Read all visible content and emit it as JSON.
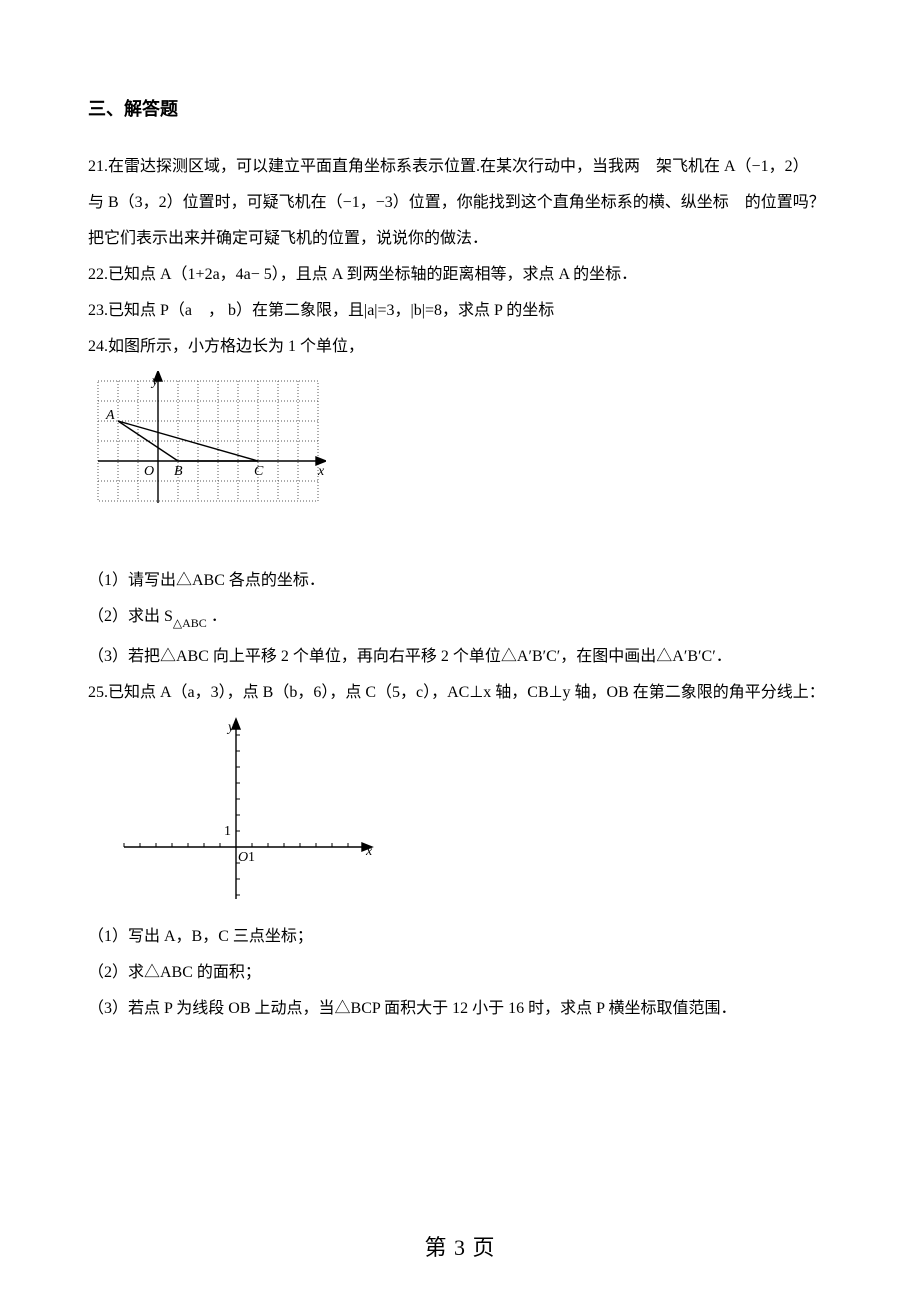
{
  "section": {
    "heading": "三、解答题"
  },
  "q21": {
    "line1": "21.在雷达探测区域，可以建立平面直角坐标系表示位置.在某次行动中，当我两　架飞机在 A（−1，2）",
    "line2": "与 B（3，2）位置时，可疑飞机在（−1，−3）位置，你能找到这个直角坐标系的横、纵坐标　的位置吗？",
    "line3": "把它们表示出来并确定可疑飞机的位置，说说你的做法．"
  },
  "q22": {
    "line": "22.已知点 A（1+2a，4a− 5），且点 A 到两坐标轴的距离相等，求点 A 的坐标．"
  },
  "q23": {
    "line": "23.已知点 P（a　， b）在第二象限，且|a|=3，|b|=8，求点 P 的坐标"
  },
  "q24": {
    "intro": "24.如图所示，小方格边长为 1 个单位，",
    "p1": "（1）请写出△ABC 各点的坐标．",
    "p2_prefix": "（2）求出 S",
    "p2_sub": "△ABC",
    "p2_suffix": " ．",
    "p3": "（3）若把△ABC 向上平移 2 个单位，再向右平移 2 个单位△A′B′C′，在图中画出△A′B′C′．",
    "fig": {
      "xlabel": "x",
      "ylabel": "y",
      "origin": "O",
      "A": "A",
      "B": "B",
      "C": "C",
      "A_coord": [
        -2,
        2
      ],
      "B_coord": [
        1,
        0
      ],
      "C_coord": [
        5,
        0
      ]
    }
  },
  "q25": {
    "intro": "25.已知点 A（a，3），点 B（b，6），点 C（5，c），AC⊥x 轴，CB⊥y 轴，OB 在第二象限的角平分线上：",
    "p1": "（1）写出 A，B，C 三点坐标；",
    "p2": "（2）求△ABC 的面积；",
    "p3": "（3）若点 P 为线段 OB 上动点，当△BCP 面积大于 12 小于 16 时，求点 P 横坐标取值范围．",
    "fig": {
      "xlabel": "x",
      "ylabel": "y",
      "origin": "O",
      "one": "1"
    }
  },
  "footer": "第 3 页",
  "chart_data": [
    {
      "type": "line",
      "name": "figure_q24",
      "description": "Dotted-grid coordinate plane with triangle ABC. Grid cell = 1 unit.",
      "x_range": [
        -3,
        8
      ],
      "y_range": [
        -2,
        4
      ],
      "points": {
        "A": [
          -2,
          2
        ],
        "B": [
          1,
          0
        ],
        "C": [
          5,
          0
        ]
      },
      "segments": [
        [
          "A",
          "B"
        ],
        [
          "A",
          "C"
        ],
        [
          "B",
          "C"
        ]
      ],
      "axis_labels": {
        "x": "x",
        "y": "y",
        "origin": "O"
      }
    },
    {
      "type": "line",
      "name": "figure_q25",
      "description": "Empty coordinate axes with tick marks; tick at 1 labeled on both axes.",
      "x_range": [
        -7,
        8
      ],
      "y_range": [
        -3,
        7
      ],
      "axis_labels": {
        "x": "x",
        "y": "y",
        "origin": "O"
      },
      "tick_labels": {
        "x": [
          1
        ],
        "y": [
          1
        ]
      }
    }
  ]
}
